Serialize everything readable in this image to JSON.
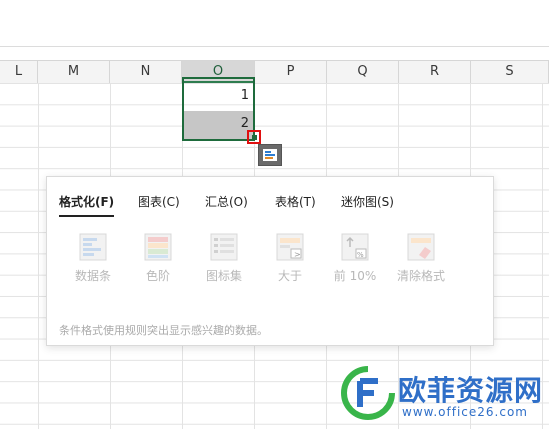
{
  "columns": [
    "L",
    "M",
    "N",
    "O",
    "P",
    "Q",
    "R",
    "S"
  ],
  "selected_column": "O",
  "cells": {
    "O1": "1",
    "O2": "2"
  },
  "panel": {
    "tabs": [
      "格式化(F)",
      "图表(C)",
      "汇总(O)",
      "表格(T)",
      "迷你图(S)"
    ],
    "active_tab": "格式化(F)",
    "tools": [
      "数据条",
      "色阶",
      "图标集",
      "大于",
      "前 10%",
      "清除格式"
    ],
    "hint": "条件格式使用规则突出显示感兴趣的数据。"
  },
  "watermark": {
    "text": "欧菲资源网",
    "url": "www.office26.com"
  }
}
